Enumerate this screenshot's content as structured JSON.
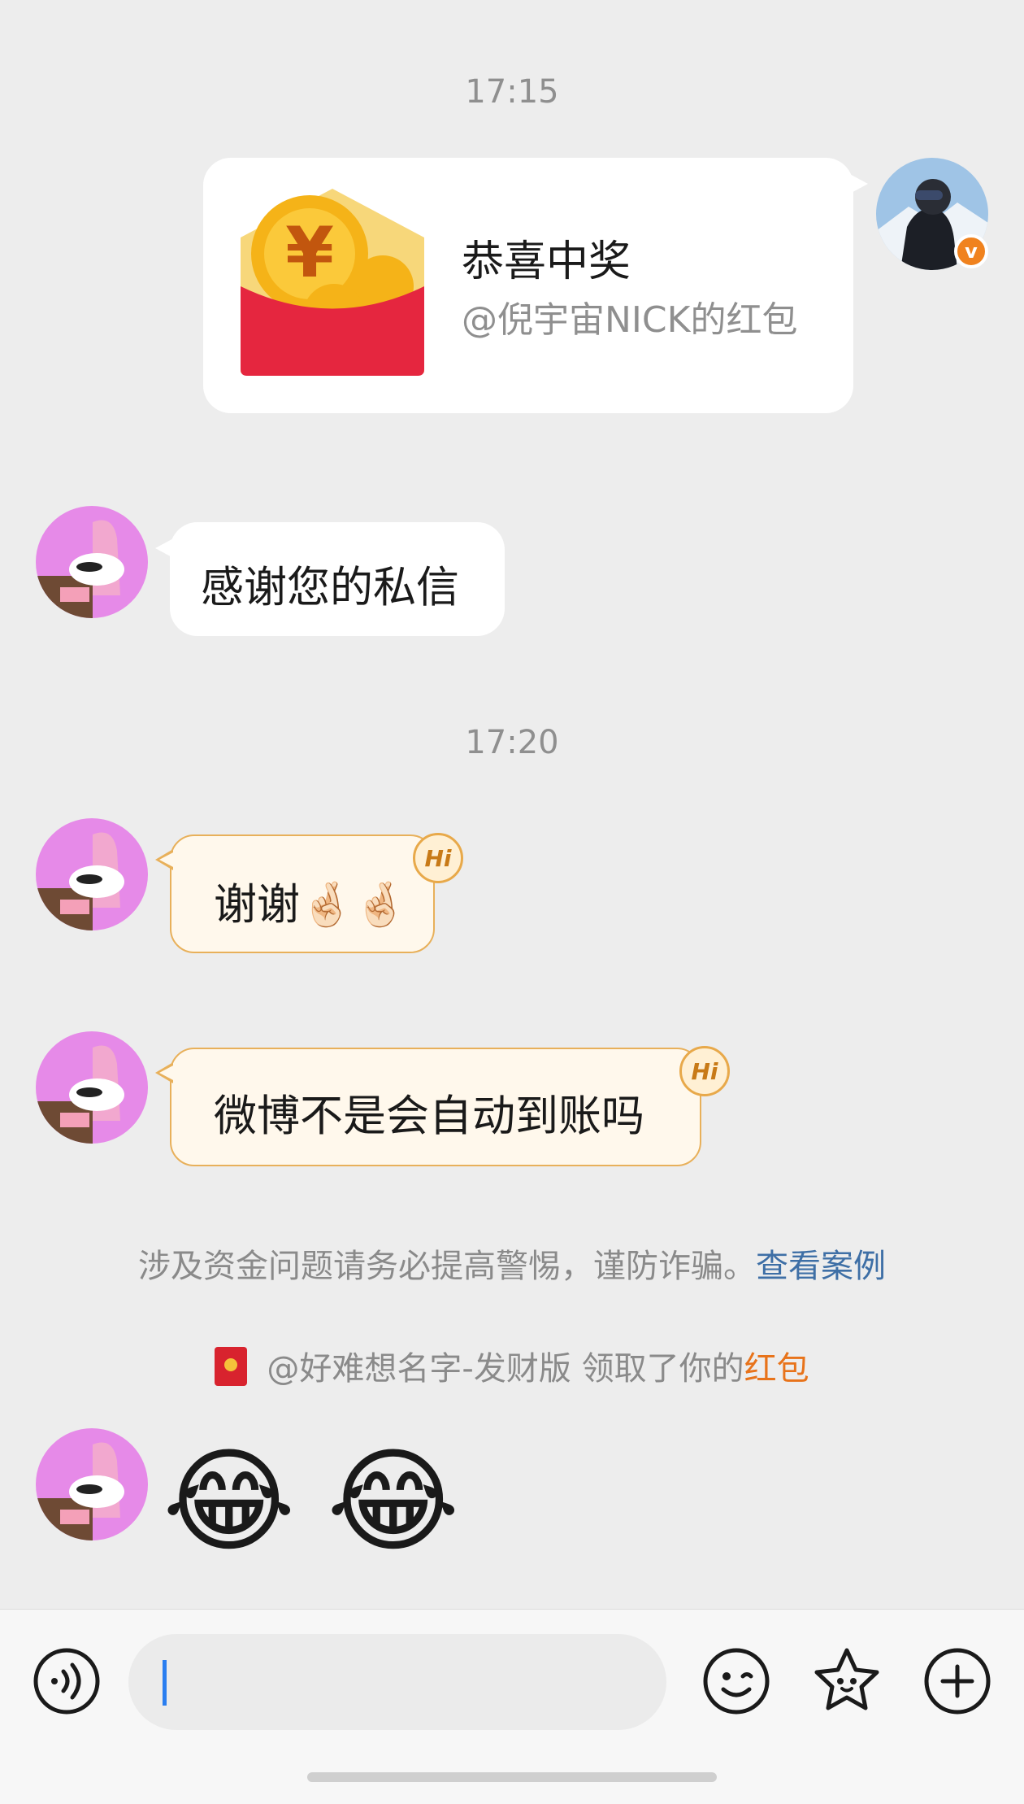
{
  "timestamps": [
    "17:15",
    "17:20"
  ],
  "red_packet": {
    "title": "恭喜中奖",
    "subtitle": "@倪宇宙NICK的红包"
  },
  "messages": [
    {
      "text": "感谢您的私信"
    },
    {
      "text": "谢谢🤞🏻🤞🏻",
      "badge": "Hi"
    },
    {
      "text": "微博不是会自动到账吗",
      "badge": "Hi"
    }
  ],
  "notice": {
    "text": "涉及资金问题请务必提高警惕，谨防诈骗。",
    "link": "查看案例"
  },
  "claim": {
    "prefix": "@好难想名字-发财版 领取了你的",
    "highlight": "红包"
  },
  "last_message": {
    "emoji": [
      "😂",
      "😂"
    ]
  },
  "colors": {
    "background": "#ededed",
    "link": "#3e6fa6",
    "highlight": "#e8731a",
    "hi_border": "#e8b05a",
    "caret": "#2a7ef0",
    "verified_badge": "#f0821e"
  },
  "icons": {
    "voice": "voice-icon",
    "emoji": "smiley-icon",
    "sticker": "star-face-icon",
    "more": "plus-icon"
  }
}
